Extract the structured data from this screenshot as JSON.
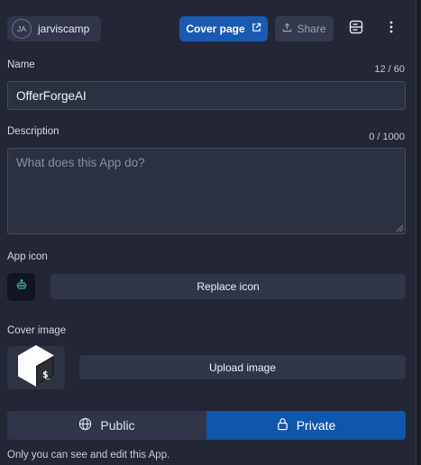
{
  "header": {
    "user_initials": "JA",
    "user_name": "jarviscamp",
    "cover_page_label": "Cover page",
    "share_label": "Share"
  },
  "name_field": {
    "label": "Name",
    "counter": "12 / 60",
    "value": "OfferForgeAI"
  },
  "description_field": {
    "label": "Description",
    "counter": "0 / 1000",
    "placeholder": "What does this App do?"
  },
  "app_icon": {
    "label": "App icon",
    "replace_label": "Replace icon"
  },
  "cover_image": {
    "label": "Cover image",
    "upload_label": "Upload image"
  },
  "visibility": {
    "public_label": "Public",
    "private_label": "Private",
    "selected": "Private",
    "note": "Only you can see and edit this App."
  },
  "colors": {
    "background": "#232735",
    "accent": "#1a5ab1",
    "selected_segment": "#0f56ad"
  },
  "icons": [
    "external-link-icon",
    "upload-icon",
    "layout-icon",
    "more-vertical-icon",
    "bot-icon",
    "bash-shell-icon",
    "globe-icon",
    "lock-icon"
  ]
}
